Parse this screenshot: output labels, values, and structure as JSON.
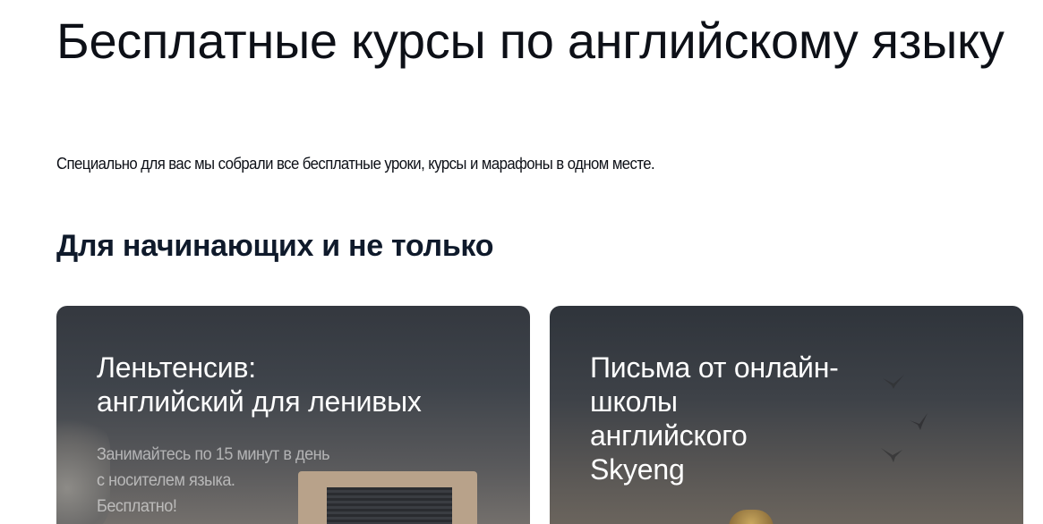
{
  "page": {
    "title": "Бесплатные курсы по английскому языку",
    "subtitle": "Специально для вас мы собрали все бесплатные уроки, курсы и марафоны в одном месте."
  },
  "section": {
    "title": "Для начинающих и не только"
  },
  "cards": [
    {
      "title": "Леньтенсив:\nанглийский для ленивых",
      "description": "Занимайтесь по 15 минут в день\nс носителем языка.\nБесплатно!"
    },
    {
      "title": "Письма от онлайн-\nшколы\nанглийского\nSkyeng"
    }
  ],
  "colors": {
    "text": "#0d1017",
    "card_text": "#ffffff",
    "card_bg": "#3a3e45"
  }
}
